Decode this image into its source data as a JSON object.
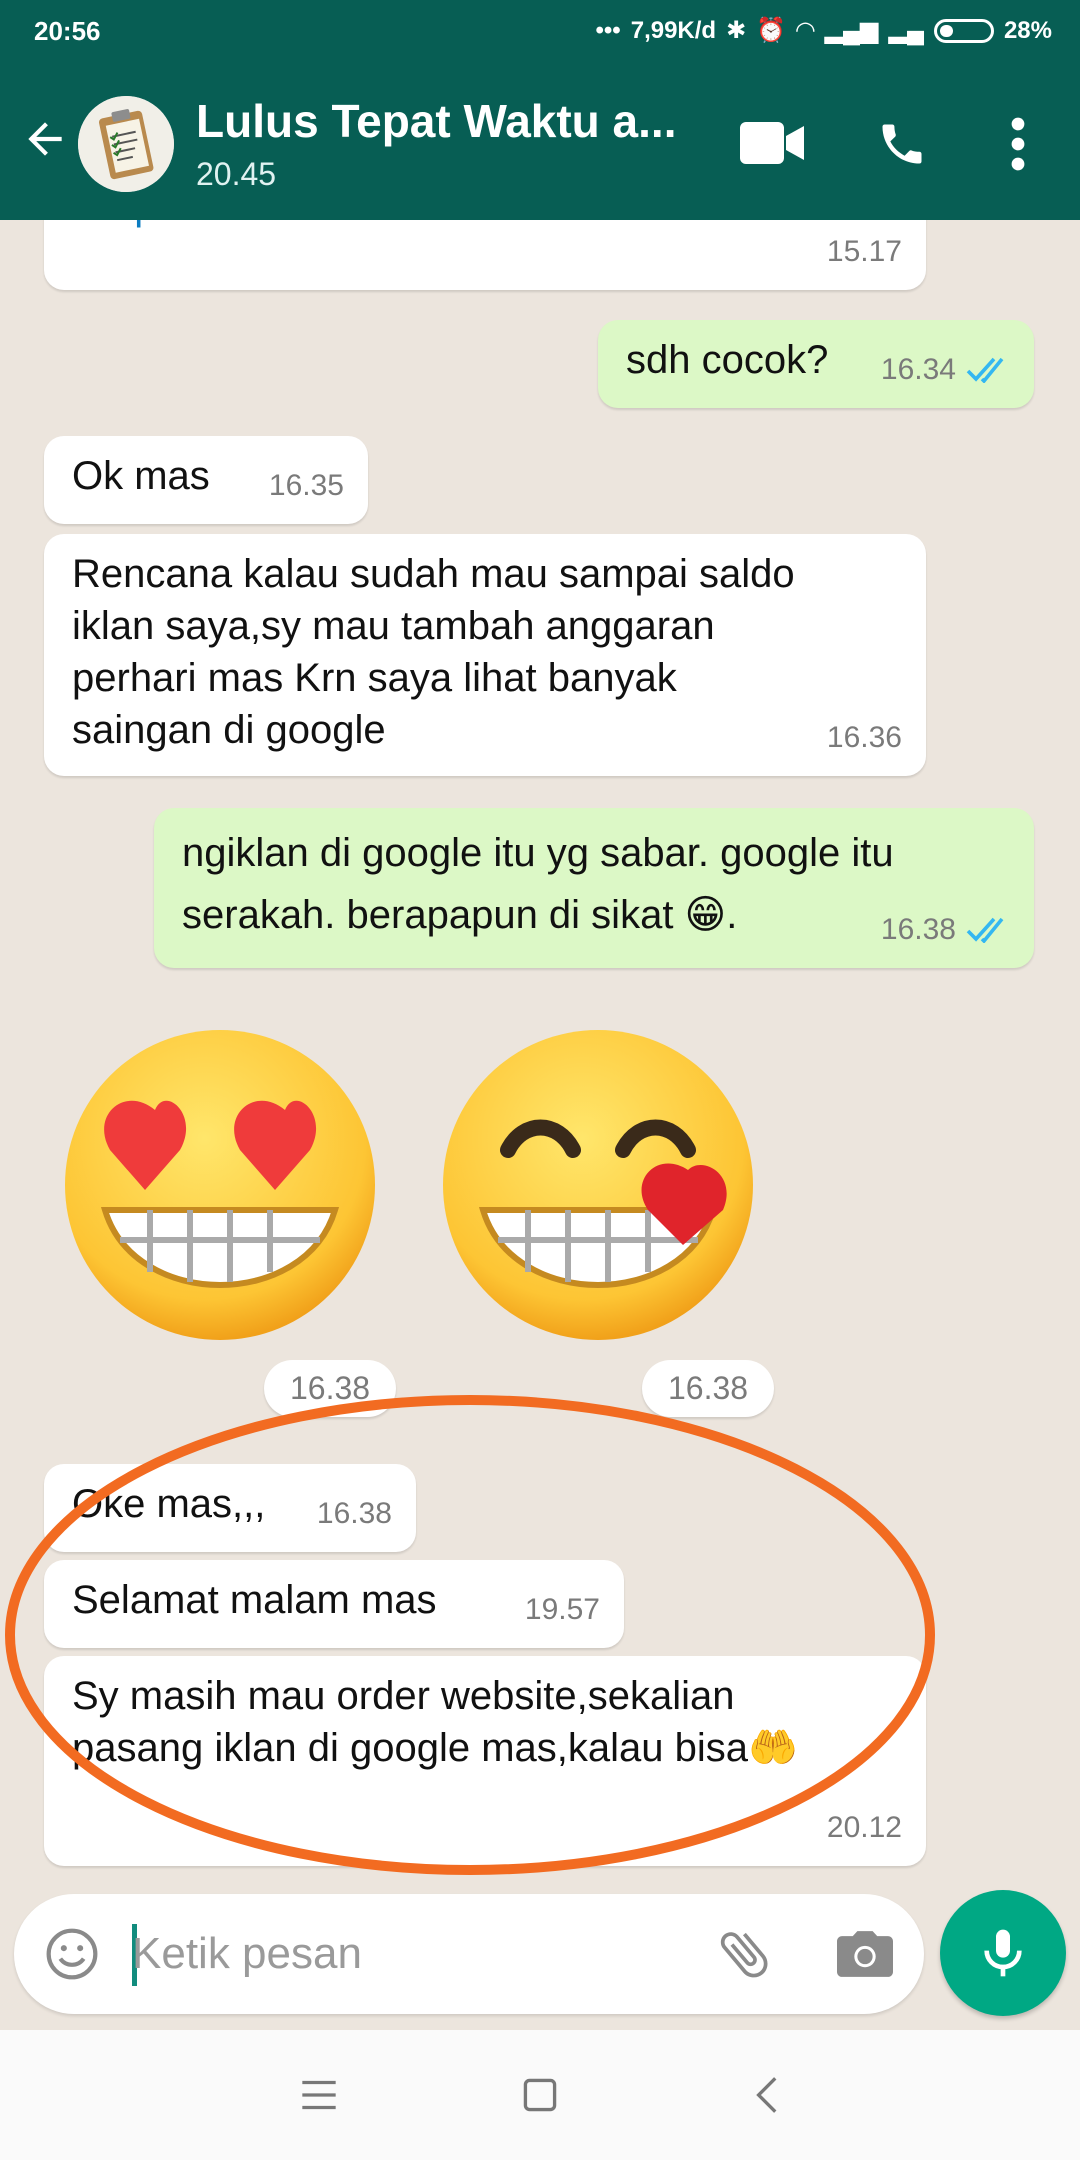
{
  "status_bar": {
    "time": "20:56",
    "network_speed": "7,99K/d",
    "battery_percent": "28%",
    "battery_level": 0.28
  },
  "header": {
    "title": "Lulus Tepat Waktu a...",
    "subtitle": "20.45"
  },
  "messages": [
    {
      "direction": "in",
      "text": "skripsi.lariz.id",
      "time": "15.17",
      "is_link": true
    },
    {
      "direction": "out",
      "text": "sdh cocok?",
      "time": "16.34",
      "read": true
    },
    {
      "direction": "in",
      "text": "Ok mas",
      "time": "16.35"
    },
    {
      "direction": "in",
      "text": "Rencana kalau sudah mau sampai saldo\niklan saya,sy mau tambah anggaran\nperhari mas Krn saya lihat banyak\nsaingan di google",
      "time": "16.36"
    },
    {
      "direction": "out",
      "text": "ngiklan di google itu yg sabar. google itu\nserakah. berapapun di sikat 😁.",
      "time": "16.38",
      "read": true
    },
    {
      "direction": "in",
      "text": "Oke mas,,,",
      "time": "16.38"
    },
    {
      "direction": "in",
      "text": "Selamat malam mas",
      "time": "19.57"
    },
    {
      "direction": "in",
      "text": "Sy masih mau order website,sekalian\npasang iklan di google mas,kalau bisa🤲",
      "time": "20.12"
    }
  ],
  "stickers": [
    {
      "name": "heart-eyes-emoji",
      "time": "16.38"
    },
    {
      "name": "smiling-heart-emoji",
      "time": "16.38"
    }
  ],
  "composer": {
    "placeholder": "Ketik pesan"
  },
  "colors": {
    "header": "#075e54",
    "incoming_bubble": "#ffffff",
    "outgoing_bubble": "#dcf8c6",
    "chat_background": "#ece5dd",
    "mic_button": "#00a884",
    "annotation": "#f26b21",
    "read_tick": "#34b7f1"
  },
  "nav": {
    "icons": [
      "menu-icon",
      "home-icon",
      "back-nav-icon"
    ]
  }
}
